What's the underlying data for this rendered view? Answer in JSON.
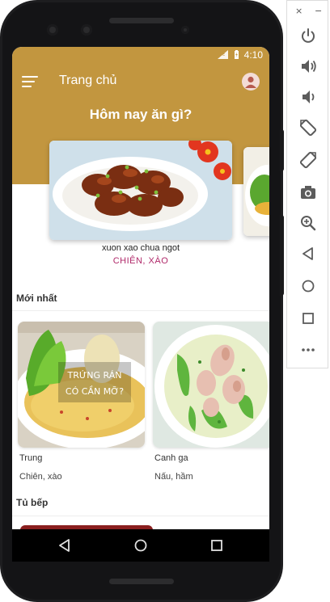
{
  "status": {
    "time": "4:10",
    "network": "LTE"
  },
  "appbar": {
    "title": "Trang chủ"
  },
  "hero": {
    "headline": "Hôm nay ăn gì?"
  },
  "featured": {
    "name": "xuon xao chua ngot",
    "category": "CHIÊN, XÀO"
  },
  "sections": {
    "latest": "Mới nhất",
    "pantry": "Tủ bếp"
  },
  "recipes": [
    {
      "name": "Trung",
      "category": "Chiên, xào",
      "overlay_text": [
        "TRỨNG RÁN",
        "CÓ CẦN MỠ?"
      ]
    },
    {
      "name": "Canh ga",
      "category": "Nấu, hầm"
    }
  ],
  "emulator": {
    "close": "×",
    "minimize": "−",
    "tools": [
      "power-icon",
      "volume-up-icon",
      "volume-down-icon",
      "rotate-left-icon",
      "rotate-right-icon",
      "camera-icon",
      "zoom-icon",
      "back-icon",
      "home-icon",
      "overview-icon",
      "more-icon"
    ]
  },
  "colors": {
    "header": "#c2963f",
    "accent": "#b0296a"
  }
}
